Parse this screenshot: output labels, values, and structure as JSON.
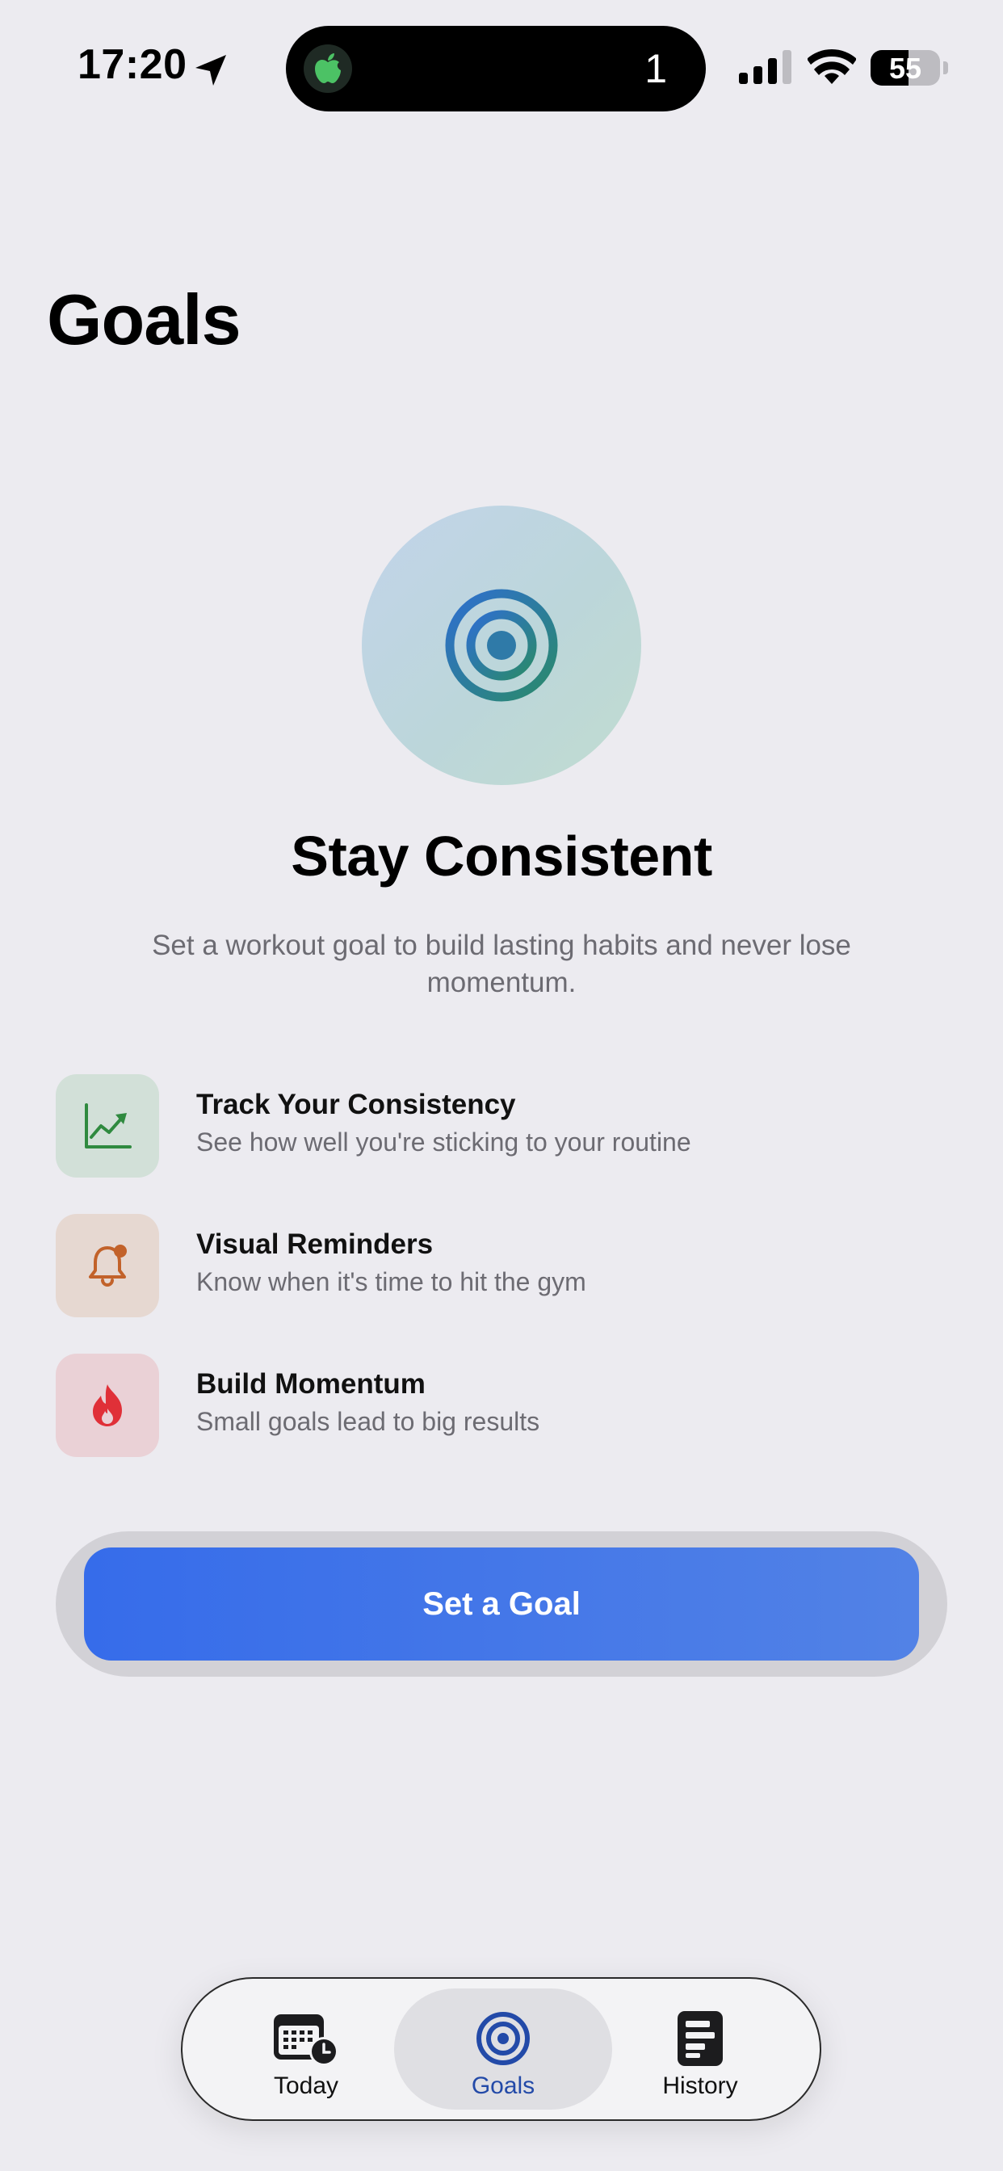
{
  "status_bar": {
    "time": "17:20",
    "island_count": "1",
    "battery_level": 55,
    "battery_text": "55"
  },
  "page": {
    "title": "Goals"
  },
  "hero": {
    "icon": "target-icon",
    "title": "Stay Consistent",
    "subtitle": "Set a workout goal to build lasting habits and never lose momentum."
  },
  "features": [
    {
      "icon": "chart-line-uptrend-icon",
      "title": "Track Your Consistency",
      "description": "See how well you're sticking to your routine",
      "tile_color": "#d2e0d8",
      "icon_color": "#2f8a3f"
    },
    {
      "icon": "bell-badge-icon",
      "title": "Visual Reminders",
      "description": "Know when it's time to hit the gym",
      "tile_color": "#e6d8d1",
      "icon_color": "#c2622a"
    },
    {
      "icon": "flame-icon",
      "title": "Build Momentum",
      "description": "Small goals lead to big results",
      "tile_color": "#ead1d6",
      "icon_color": "#e03038"
    }
  ],
  "cta": {
    "label": "Set a Goal",
    "color": "#3a6feb"
  },
  "tab_bar": {
    "tabs": [
      {
        "label": "Today",
        "icon": "calendar-clock-icon",
        "active": false
      },
      {
        "label": "Goals",
        "icon": "target-icon",
        "active": true
      },
      {
        "label": "History",
        "icon": "list-document-icon",
        "active": false
      }
    ],
    "active_color": "#234aa8"
  }
}
